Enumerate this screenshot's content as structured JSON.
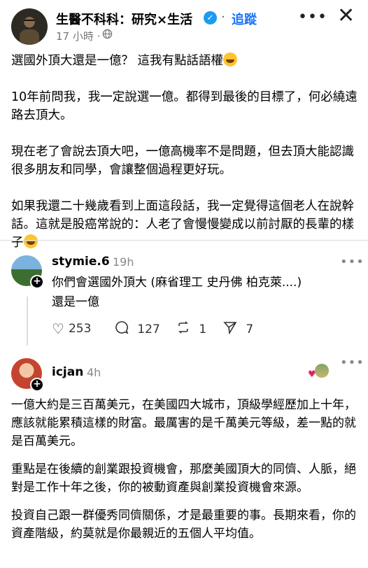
{
  "post": {
    "author": "生醫不科科：研究×生活",
    "verified_symbol": "✓",
    "separator": "·",
    "follow_label": "追蹤",
    "menu": "•••",
    "close": "✕",
    "time": "17 小時",
    "visibility_separator": "·",
    "visibility_icon": "globe-icon",
    "paragraphs": [
      "選國外頂大還是一億？ 這我有點話語權",
      "10年前問我，我一定說選一億。都得到最後的目標了，何必繞遠路去頂大。",
      "現在老了會說去頂大吧，一億高機率不是問題，但去頂大能認識很多朋友和同學，會讓整個過程更好玩。",
      "如果我還二十幾歲看到上面這段話，我一定覺得這個老人在說幹話。這就是股癌常說的：人老了會慢慢變成以前討厭的長輩的樣子"
    ]
  },
  "comment1": {
    "user": "stymie.6",
    "time": "19h",
    "menu": "•••",
    "lines": [
      "你們會選國外頂大 (麻省理工 史丹佛 柏克萊....)",
      "還是一億"
    ],
    "plus": "+",
    "likes": "253",
    "replies": "127",
    "reposts": "1",
    "shares": "7"
  },
  "comment2": {
    "user": "icjan",
    "time": "4h",
    "menu": "•••",
    "plus": "+",
    "paragraphs": [
      "一億大約是三百萬美元，在美國四大城市，頂級學經歷加上十年，應該就能累積這樣的財富。最厲害的是千萬美元等級，差一點的就是百萬美元。",
      "重點是在後續的創業跟投資機會，那麼美國頂大的同儕、人脈，絕對是工作十年之後，你的被動資產與創業投資機會來源。",
      "投資自己跟一群優秀同儕關係，才是最重要的事。長期來看，你的資產階級，約莫就是你最親近的五個人平均值。"
    ]
  },
  "colors": {
    "follow": "#1d74f5",
    "verified": "#1d9bf0",
    "heart": "#e0245e",
    "muted": "#888888"
  }
}
